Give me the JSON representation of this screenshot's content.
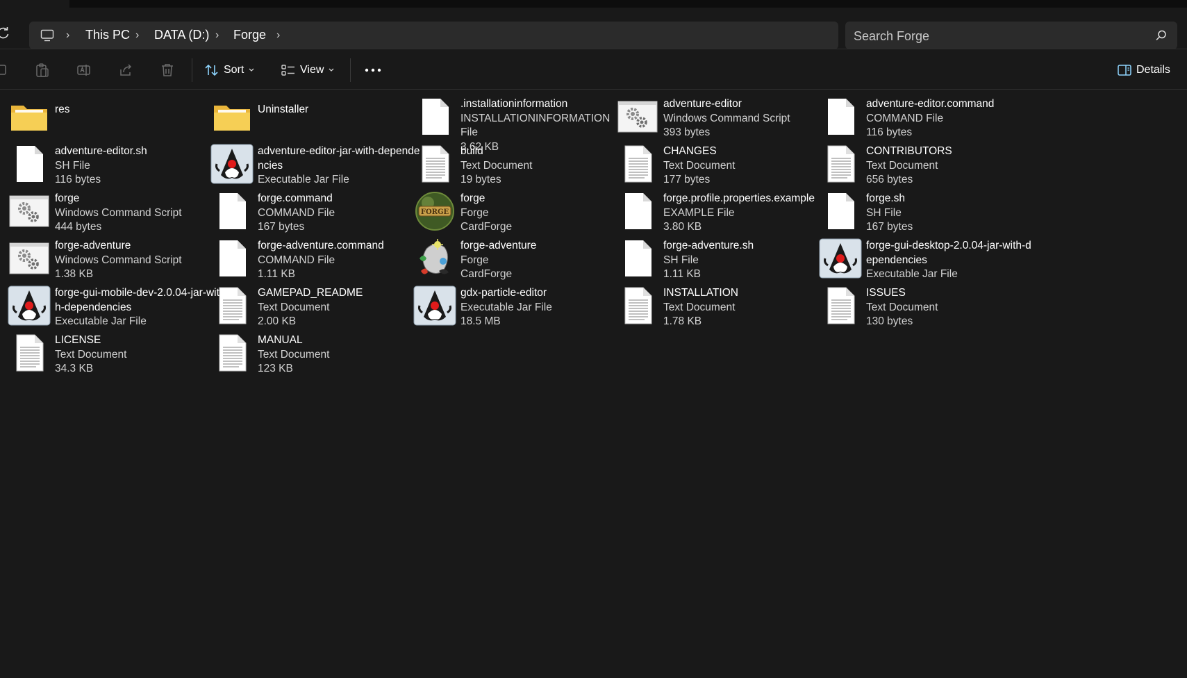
{
  "address": {
    "crumbs": [
      "This PC",
      "DATA (D:)",
      "Forge"
    ]
  },
  "search": {
    "placeholder": "Search Forge"
  },
  "toolbar": {
    "sort_label": "Sort",
    "view_label": "View",
    "details_label": "Details"
  },
  "colors": {
    "background": "#191919",
    "panel": "#2b2b2b",
    "folder": "#f2c447",
    "accent": "#60cdff"
  },
  "files": [
    {
      "name": "res",
      "type": "",
      "size": "",
      "icon": "folder-icon"
    },
    {
      "name": "Uninstaller",
      "type": "",
      "size": "",
      "icon": "folder-icon"
    },
    {
      "name": ".installationinformation",
      "type": "INSTALLATIONINFORMATION File",
      "size": "3.62 KB",
      "icon": "blank-file-icon"
    },
    {
      "name": "adventure-editor",
      "type": "Windows Command Script",
      "size": "393 bytes",
      "icon": "script-gear-icon"
    },
    {
      "name": "adventure-editor.command",
      "type": "COMMAND File",
      "size": "116 bytes",
      "icon": "blank-file-icon"
    },
    {
      "name": "adventure-editor.sh",
      "type": "SH File",
      "size": "116 bytes",
      "icon": "blank-file-icon"
    },
    {
      "name": "adventure-editor-jar-with-dependencies",
      "type": "Executable Jar File",
      "size": "",
      "icon": "java-duke-icon"
    },
    {
      "name": "build",
      "type": "Text Document",
      "size": "19 bytes",
      "icon": "text-document-icon"
    },
    {
      "name": "CHANGES",
      "type": "Text Document",
      "size": "177 bytes",
      "icon": "text-document-icon"
    },
    {
      "name": "CONTRIBUTORS",
      "type": "Text Document",
      "size": "656 bytes",
      "icon": "text-document-icon"
    },
    {
      "name": "forge",
      "type": "Windows Command Script",
      "size": "444 bytes",
      "icon": "script-gear-icon"
    },
    {
      "name": "forge.command",
      "type": "COMMAND File",
      "size": "167 bytes",
      "icon": "blank-file-icon"
    },
    {
      "name": "forge",
      "type": "Forge",
      "size": "CardForge",
      "icon": "forge-app-icon"
    },
    {
      "name": "forge.profile.properties.example",
      "type": "EXAMPLE File",
      "size": "3.80 KB",
      "icon": "blank-file-icon"
    },
    {
      "name": "forge.sh",
      "type": "SH File",
      "size": "167 bytes",
      "icon": "blank-file-icon"
    },
    {
      "name": "forge-adventure",
      "type": "Windows Command Script",
      "size": "1.38 KB",
      "icon": "script-gear-icon"
    },
    {
      "name": "forge-adventure.command",
      "type": "COMMAND File",
      "size": "1.11 KB",
      "icon": "blank-file-icon"
    },
    {
      "name": "forge-adventure",
      "type": "Forge",
      "size": "CardForge",
      "icon": "forge-adventure-icon"
    },
    {
      "name": "forge-adventure.sh",
      "type": "SH File",
      "size": "1.11 KB",
      "icon": "blank-file-icon"
    },
    {
      "name": "forge-gui-desktop-2.0.04-jar-with-dependencies",
      "type": "Executable Jar File",
      "size": "",
      "icon": "java-duke-icon"
    },
    {
      "name": "forge-gui-mobile-dev-2.0.04-jar-with-dependencies",
      "type": "Executable Jar File",
      "size": "",
      "icon": "java-duke-icon"
    },
    {
      "name": "GAMEPAD_README",
      "type": "Text Document",
      "size": "2.00 KB",
      "icon": "text-document-icon"
    },
    {
      "name": "gdx-particle-editor",
      "type": "Executable Jar File",
      "size": "18.5 MB",
      "icon": "java-duke-icon"
    },
    {
      "name": "INSTALLATION",
      "type": "Text Document",
      "size": "1.78 KB",
      "icon": "text-document-icon"
    },
    {
      "name": "ISSUES",
      "type": "Text Document",
      "size": "130 bytes",
      "icon": "text-document-icon"
    },
    {
      "name": "LICENSE",
      "type": "Text Document",
      "size": "34.3 KB",
      "icon": "text-document-icon"
    },
    {
      "name": "MANUAL",
      "type": "Text Document",
      "size": "123 KB",
      "icon": "text-document-icon"
    }
  ]
}
